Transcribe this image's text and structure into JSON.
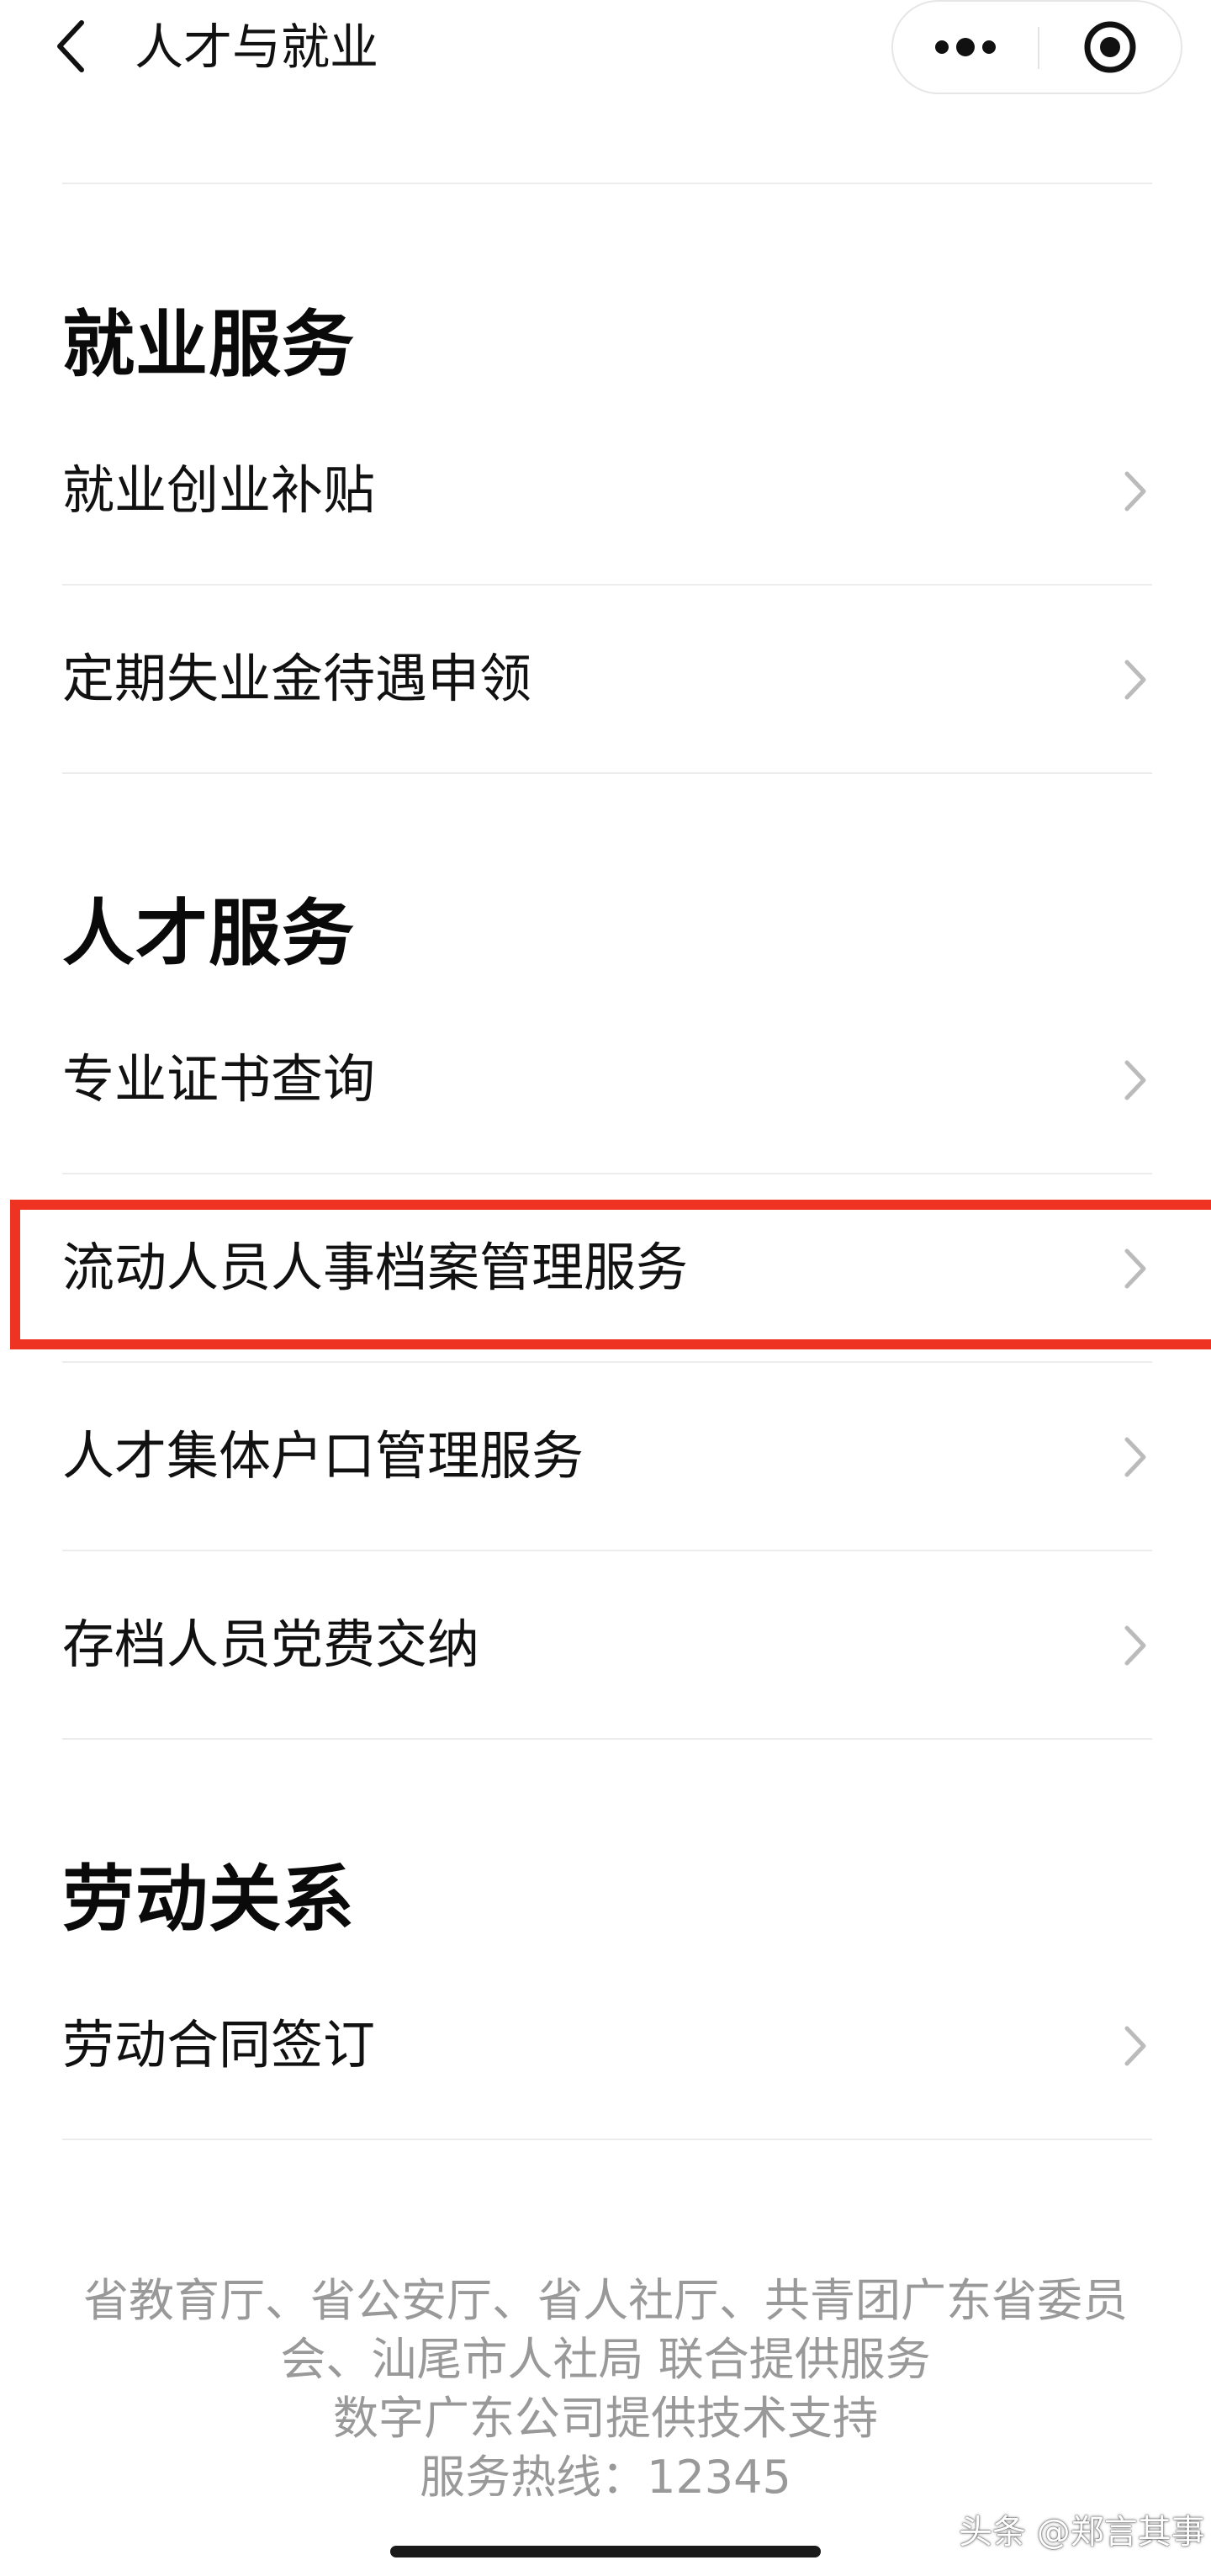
{
  "header": {
    "title": "人才与就业",
    "back_icon": "chevron-left-icon",
    "more_icon": "more-dots-icon",
    "close_icon": "target-close-icon"
  },
  "sections": [
    {
      "title": "就业服务",
      "items": [
        {
          "label": "就业创业补贴"
        },
        {
          "label": "定期失业金待遇申领"
        }
      ]
    },
    {
      "title": "人才服务",
      "items": [
        {
          "label": "专业证书查询"
        },
        {
          "label": "流动人员人事档案管理服务"
        },
        {
          "label": "人才集体户口管理服务"
        },
        {
          "label": "存档人员党费交纳"
        }
      ]
    },
    {
      "title": "劳动关系",
      "items": [
        {
          "label": "劳动合同签订"
        }
      ]
    }
  ],
  "highlight": {
    "item_label": "流动人员人事档案管理服务",
    "color": "#ee3322"
  },
  "footer": {
    "line1": "省教育厅、省公安厅、省人社厅、共青团广东省委员",
    "line2": "会、汕尾市人社局 联合提供服务",
    "line3": "数字广东公司提供技术支持",
    "line4": "服务热线：12345"
  },
  "watermark": "头条 @郑言其事",
  "colors": {
    "text": "#111111",
    "divider": "#ececec",
    "chevron": "#bbbbbb",
    "footer_text": "#999999"
  }
}
